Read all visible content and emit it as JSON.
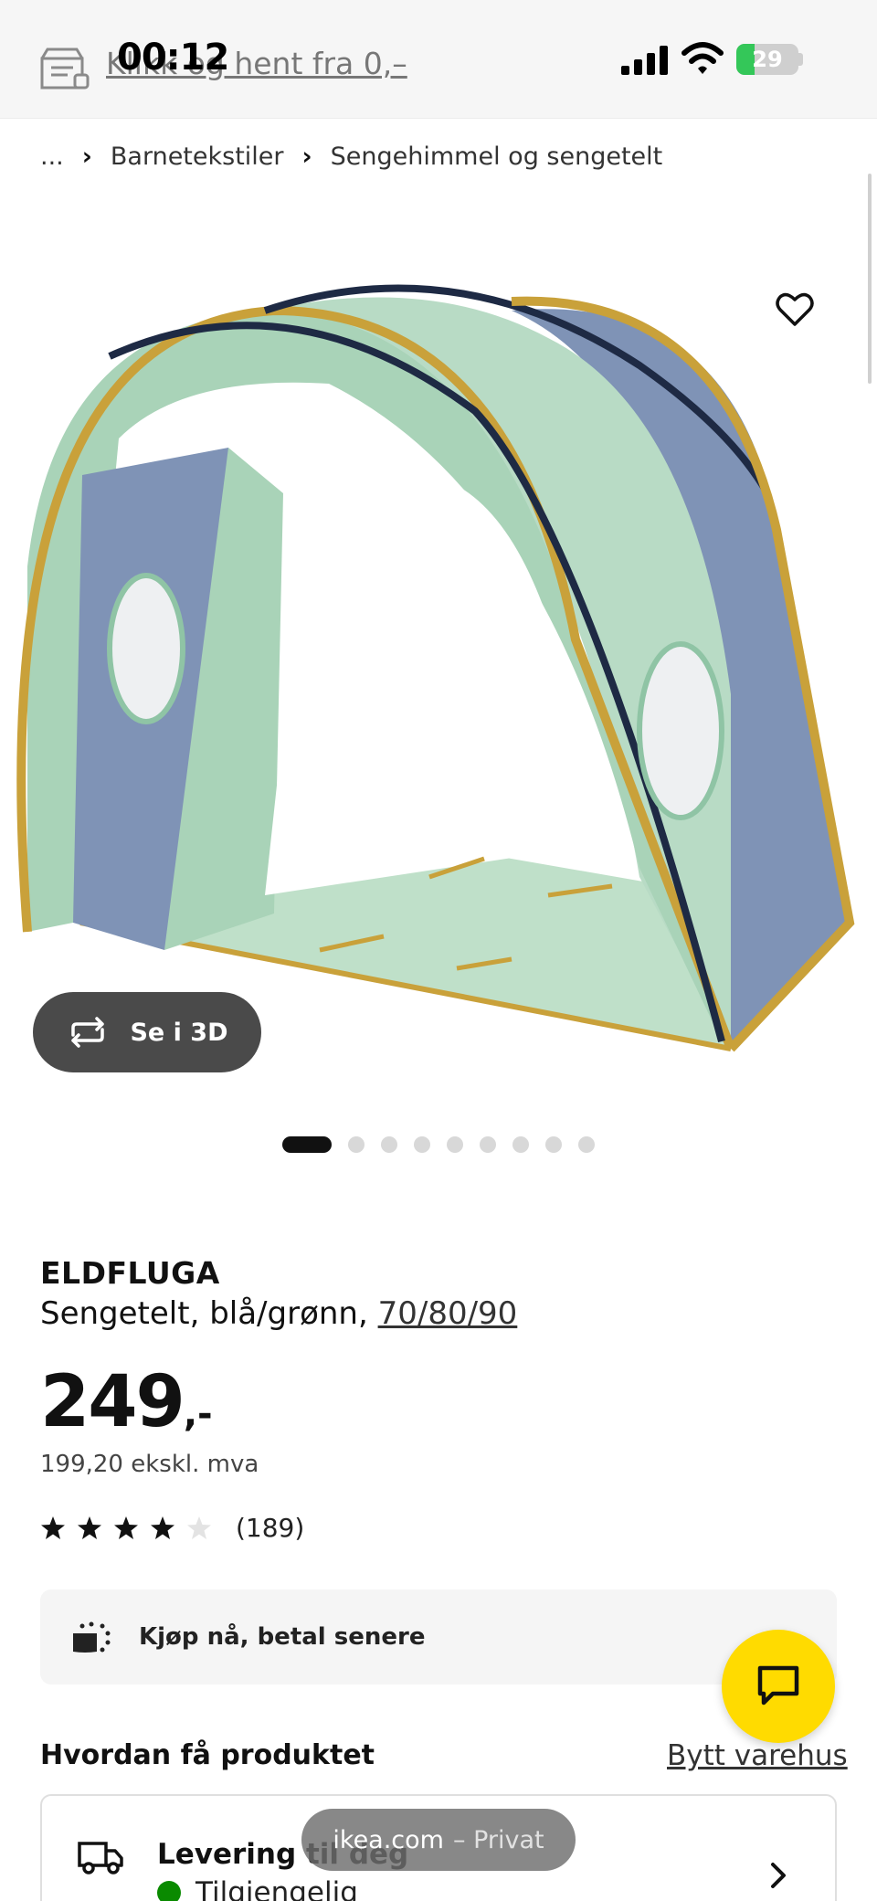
{
  "status_bar": {
    "time": "00:12",
    "battery_percent": "29",
    "battery_level": 0.29
  },
  "store_banner": {
    "link_text": "Klikk og hent fra 0,–"
  },
  "breadcrumb": {
    "ellipsis": "...",
    "items": [
      "Barnetekstiler",
      "Sengehimmel og sengetelt"
    ]
  },
  "media": {
    "view_3d_label": "Se i 3D",
    "slide_count": 9,
    "active_slide": 1
  },
  "product": {
    "name": "ELDFLUGA",
    "description": "Sengetelt, blå/grønn,",
    "size": "70/80/90",
    "price": "249",
    "price_suffix": ",-",
    "price_excl_vat": "199,20 ekskl. mva",
    "rating": 4,
    "rating_max": 5,
    "review_count": "(189)"
  },
  "payment": {
    "label": "Kjøp nå, betal senere"
  },
  "delivery": {
    "section_title": "Hvordan få produktet",
    "change_store": "Bytt varehus",
    "option_title": "Levering til deg",
    "availability": "Tilgjengelig"
  },
  "browser": {
    "domain": "ikea.com",
    "mode": "– Privat"
  },
  "colors": {
    "accent_yellow": "#ffdb00",
    "available_green": "#0a8a00",
    "dark_button": "#4a4a4a"
  },
  "icons": [
    "store-icon",
    "heart-icon",
    "rotate-3d-icon",
    "klarna-icon",
    "chat-icon",
    "truck-icon",
    "chevron-right-icon"
  ]
}
